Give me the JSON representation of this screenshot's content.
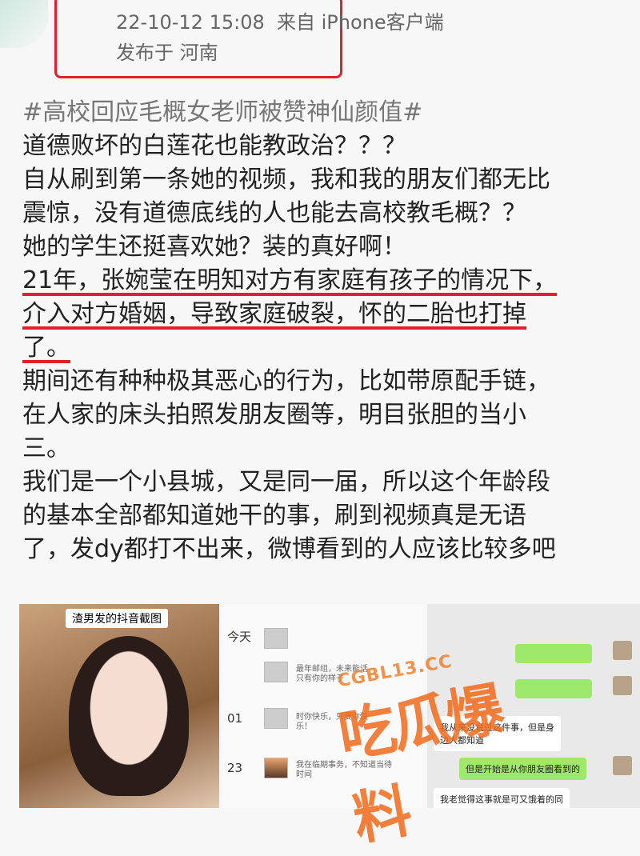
{
  "meta": {
    "timestamp": "22-10-12 15:08",
    "source": "来自 iPhone客户端",
    "location": "发布于 河南"
  },
  "post": {
    "hashtag": "#高校回应毛概女老师被赞神仙颜值#",
    "lines": [
      "道德败坏的白莲花也能教政治？？？",
      "自从刷到第一条她的视频，我和我的朋友们都无比",
      "震惊，没有道德底线的人也能去高校教毛概？？",
      "她的学生还挺喜欢她？装的真好啊！",
      "21年，张婉莹在明知对方有家庭有孩子的情况下，",
      "介入对方婚姻，导致家庭破裂，怀的二胎也打掉",
      "了。",
      "期间还有种种极其恶心的行为，比如带原配手链，",
      "在人家的床头拍照发朋友圈等，明目张胆的当小",
      "三。",
      "我们是一个小县城，又是同一届，所以这个年龄段",
      "的基本全部都知道她干的事，刷到视频真是无语",
      "了，发dy都打不出来，微博看到的人应该比较多吧"
    ]
  },
  "images": {
    "left_caption": "渣男发的抖音截图",
    "middle": {
      "today": "今天",
      "date1": "01",
      "date2": "23",
      "snippet1": "最年邮组，未来能话\n只有你的样子",
      "snippet2": "时你快乐，只要你快\n乐！",
      "snippet3": "我在临期事务，不知道当待\n时间"
    },
    "right": {
      "bubble1": "我从来没说过这件事，但是身\n边人都知道",
      "bubble2": "但是开始是从你朋友圈看到的",
      "bubble3": "我老觉得这事就是可又饿着的同"
    }
  },
  "watermark": {
    "sub": "CGBL13.CC",
    "main": "吃瓜爆料"
  }
}
